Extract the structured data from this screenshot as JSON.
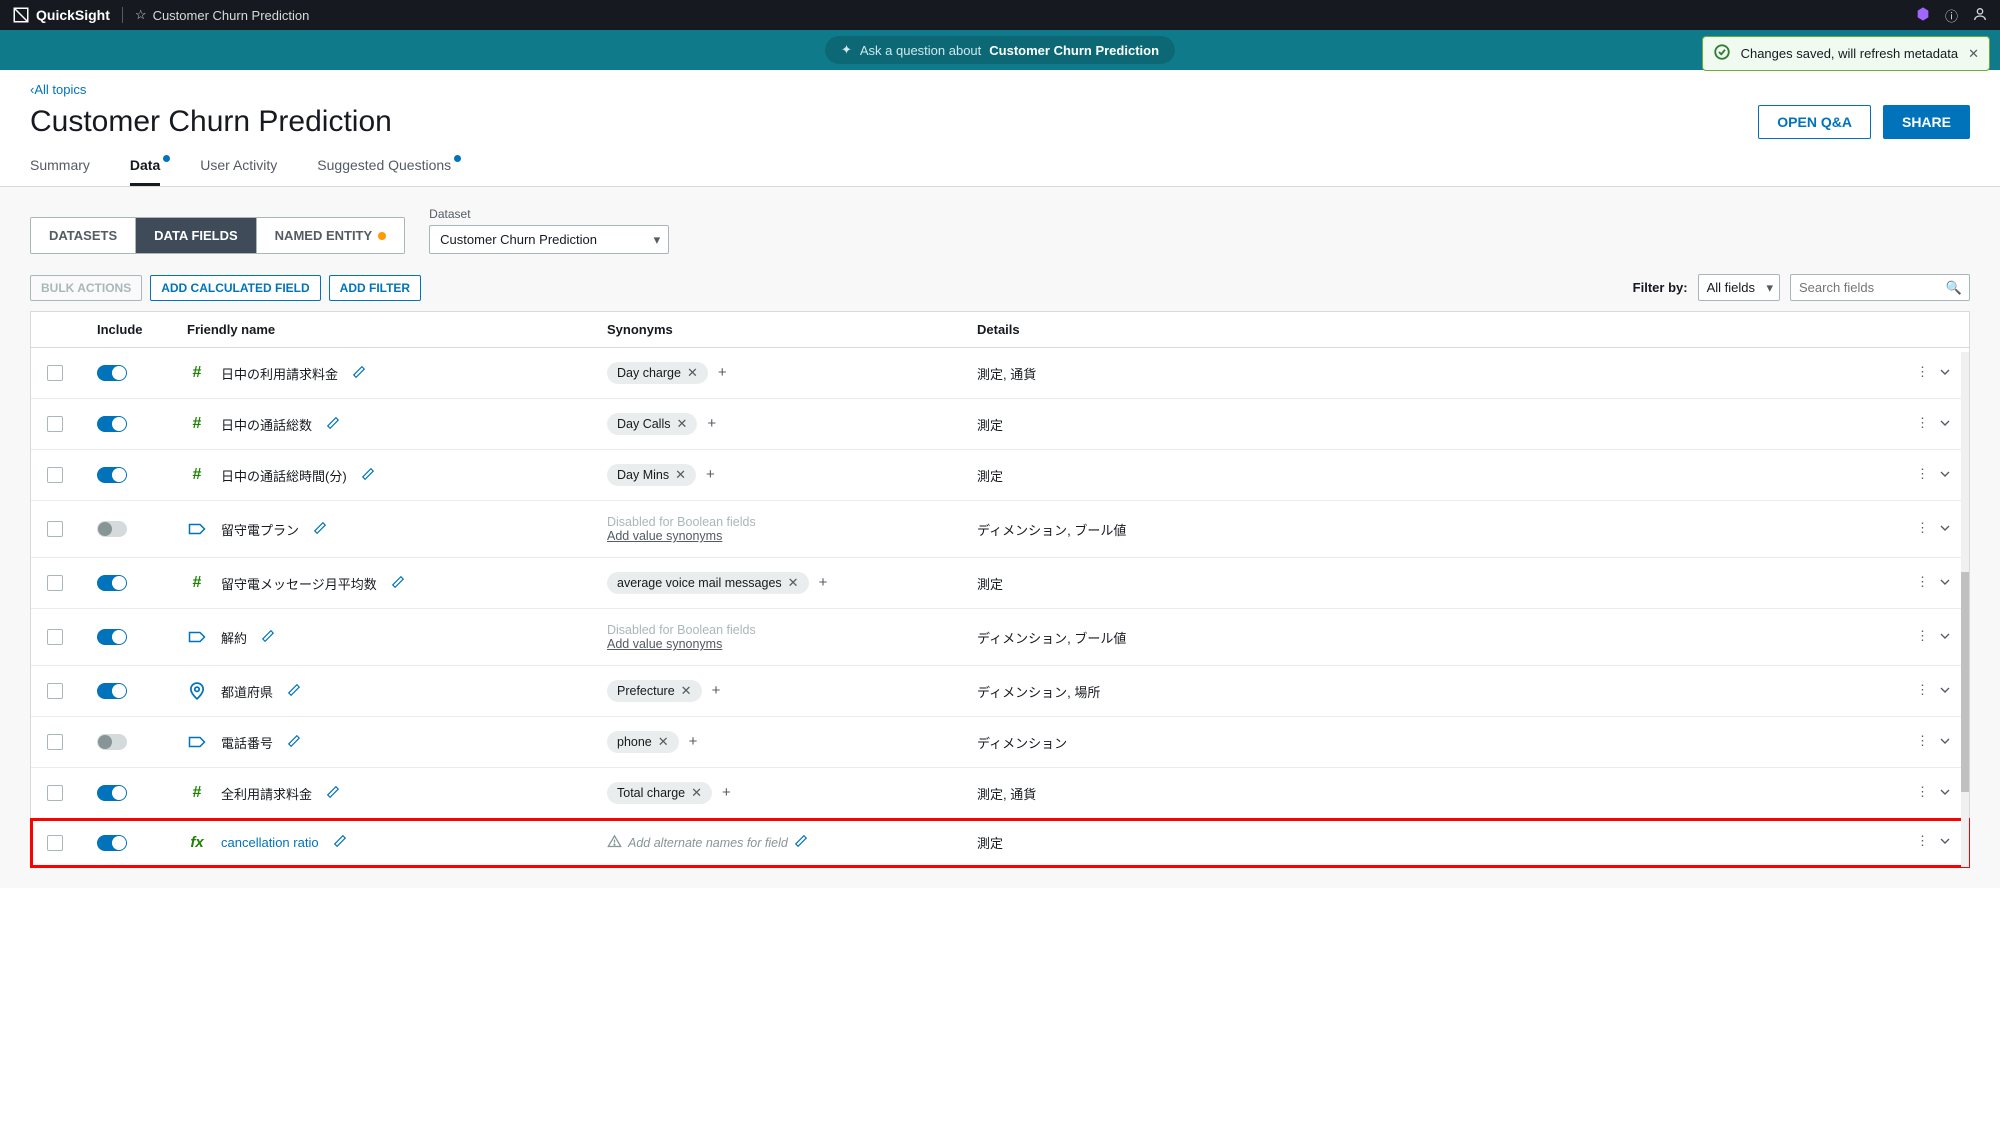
{
  "topbar": {
    "app": "QuickSight",
    "title": "Customer Churn Prediction"
  },
  "askbar": {
    "prefix": "Ask a question about",
    "subject": "Customer Churn Prediction"
  },
  "toast": {
    "message": "Changes saved, will refresh metadata"
  },
  "breadcrumb": {
    "back": "All topics"
  },
  "page": {
    "title": "Customer Churn Prediction",
    "open_qa": "OPEN Q&A",
    "share": "SHARE"
  },
  "tabs": {
    "summary": "Summary",
    "data": "Data",
    "user_activity": "User Activity",
    "suggested": "Suggested Questions"
  },
  "subtabs": {
    "datasets": "DATASETS",
    "fields": "DATA FIELDS",
    "entity": "NAMED ENTITY"
  },
  "dataset": {
    "label": "Dataset",
    "value": "Customer Churn Prediction"
  },
  "actions": {
    "bulk": "BULK ACTIONS",
    "add_calc": "ADD CALCULATED FIELD",
    "add_filter": "ADD FILTER",
    "filter_by": "Filter by:",
    "filter_value": "All fields",
    "search_placeholder": "Search fields"
  },
  "columns": {
    "include": "Include",
    "friendly": "Friendly name",
    "synonyms": "Synonyms",
    "details": "Details"
  },
  "rows": [
    {
      "type": "hash",
      "include": true,
      "name": "日中の利用請求料金",
      "syn_chip": "Day charge",
      "details": "測定, 通貨"
    },
    {
      "type": "hash",
      "include": true,
      "name": "日中の通話総数",
      "syn_chip": "Day Calls",
      "details": "測定"
    },
    {
      "type": "hash",
      "include": true,
      "name": "日中の通話総時間(分)",
      "syn_chip": "Day Mins",
      "details": "測定"
    },
    {
      "type": "tag",
      "include": false,
      "name": "留守電プラン",
      "syn_disabled": "Disabled for Boolean fields",
      "syn_link": "Add value synonyms",
      "details": "ディメンション, ブール値"
    },
    {
      "type": "hash",
      "include": true,
      "name": "留守電メッセージ月平均数",
      "syn_chip": "average voice mail messages",
      "details": "測定"
    },
    {
      "type": "tag",
      "include": true,
      "name": "解約",
      "syn_disabled": "Disabled for Boolean fields",
      "syn_link": "Add value synonyms",
      "details": "ディメンション, ブール値"
    },
    {
      "type": "pin",
      "include": true,
      "name": "都道府県",
      "syn_chip": "Prefecture",
      "details": "ディメンション, 場所"
    },
    {
      "type": "tag",
      "include": false,
      "name": "電話番号",
      "syn_chip": "phone",
      "details": "ディメンション"
    },
    {
      "type": "hash",
      "include": true,
      "name": "全利用請求料金",
      "syn_chip": "Total charge",
      "details": "測定, 通貨"
    },
    {
      "type": "fx",
      "include": true,
      "name": "cancellation ratio",
      "syn_hint": "Add alternate names for field",
      "details": "測定",
      "highlight": true,
      "link": true
    }
  ]
}
